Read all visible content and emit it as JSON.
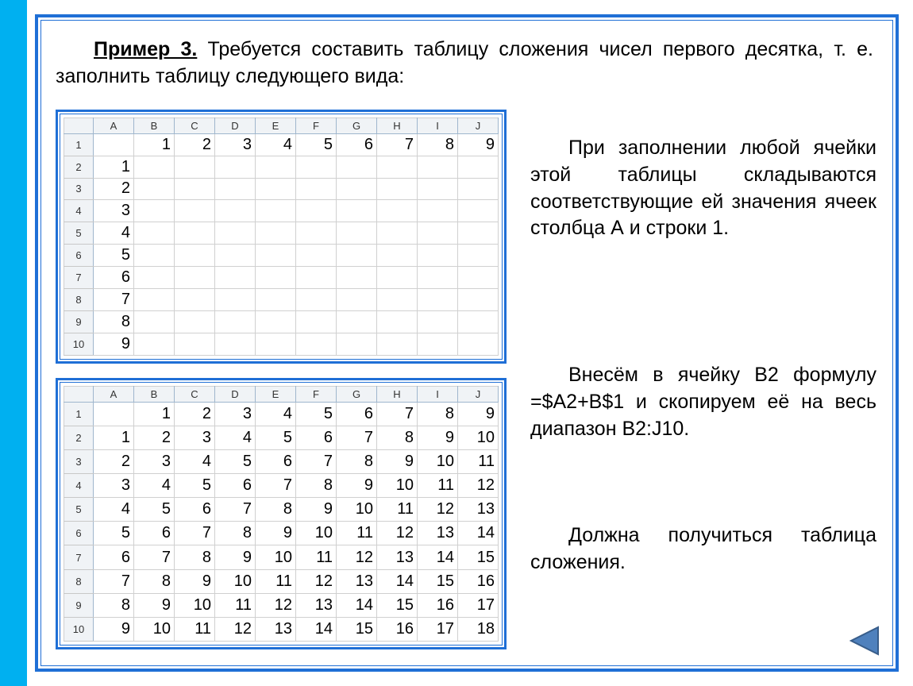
{
  "intro": {
    "title": "Пример 3.",
    "text": " Требуется составить таблицу сложения чисел первого десятка, т. е. заполнить таблицу следующего вида:"
  },
  "para1": "При заполнении любой ячейки этой таблицы складываются соответствующие ей значения ячеек столбца А и строки 1.",
  "para2": "Внесём в ячейку В2 формулу =$A2+B$1 и скопируем её на весь диапазон B2:J10.",
  "para3": "Должна получиться таблица сложения.",
  "columns": [
    "A",
    "B",
    "C",
    "D",
    "E",
    "F",
    "G",
    "H",
    "I",
    "J"
  ],
  "rownums": [
    "1",
    "2",
    "3",
    "4",
    "5",
    "6",
    "7",
    "8",
    "9",
    "10"
  ],
  "sheet1": {
    "rows": [
      [
        "",
        "1",
        "2",
        "3",
        "4",
        "5",
        "6",
        "7",
        "8",
        "9"
      ],
      [
        "1",
        "",
        "",
        "",
        "",
        "",
        "",
        "",
        "",
        ""
      ],
      [
        "2",
        "",
        "",
        "",
        "",
        "",
        "",
        "",
        "",
        ""
      ],
      [
        "3",
        "",
        "",
        "",
        "",
        "",
        "",
        "",
        "",
        ""
      ],
      [
        "4",
        "",
        "",
        "",
        "",
        "",
        "",
        "",
        "",
        ""
      ],
      [
        "5",
        "",
        "",
        "",
        "",
        "",
        "",
        "",
        "",
        ""
      ],
      [
        "6",
        "",
        "",
        "",
        "",
        "",
        "",
        "",
        "",
        ""
      ],
      [
        "7",
        "",
        "",
        "",
        "",
        "",
        "",
        "",
        "",
        ""
      ],
      [
        "8",
        "",
        "",
        "",
        "",
        "",
        "",
        "",
        "",
        ""
      ],
      [
        "9",
        "",
        "",
        "",
        "",
        "",
        "",
        "",
        "",
        ""
      ]
    ]
  },
  "sheet2": {
    "rows": [
      [
        "",
        "1",
        "2",
        "3",
        "4",
        "5",
        "6",
        "7",
        "8",
        "9"
      ],
      [
        "1",
        "2",
        "3",
        "4",
        "5",
        "6",
        "7",
        "8",
        "9",
        "10"
      ],
      [
        "2",
        "3",
        "4",
        "5",
        "6",
        "7",
        "8",
        "9",
        "10",
        "11"
      ],
      [
        "3",
        "4",
        "5",
        "6",
        "7",
        "8",
        "9",
        "10",
        "11",
        "12"
      ],
      [
        "4",
        "5",
        "6",
        "7",
        "8",
        "9",
        "10",
        "11",
        "12",
        "13"
      ],
      [
        "5",
        "6",
        "7",
        "8",
        "9",
        "10",
        "11",
        "12",
        "13",
        "14"
      ],
      [
        "6",
        "7",
        "8",
        "9",
        "10",
        "11",
        "12",
        "13",
        "14",
        "15"
      ],
      [
        "7",
        "8",
        "9",
        "10",
        "11",
        "12",
        "13",
        "14",
        "15",
        "16"
      ],
      [
        "8",
        "9",
        "10",
        "11",
        "12",
        "13",
        "14",
        "15",
        "16",
        "17"
      ],
      [
        "9",
        "10",
        "11",
        "12",
        "13",
        "14",
        "15",
        "16",
        "17",
        "18"
      ]
    ]
  },
  "nav": {
    "back_label": "back"
  }
}
